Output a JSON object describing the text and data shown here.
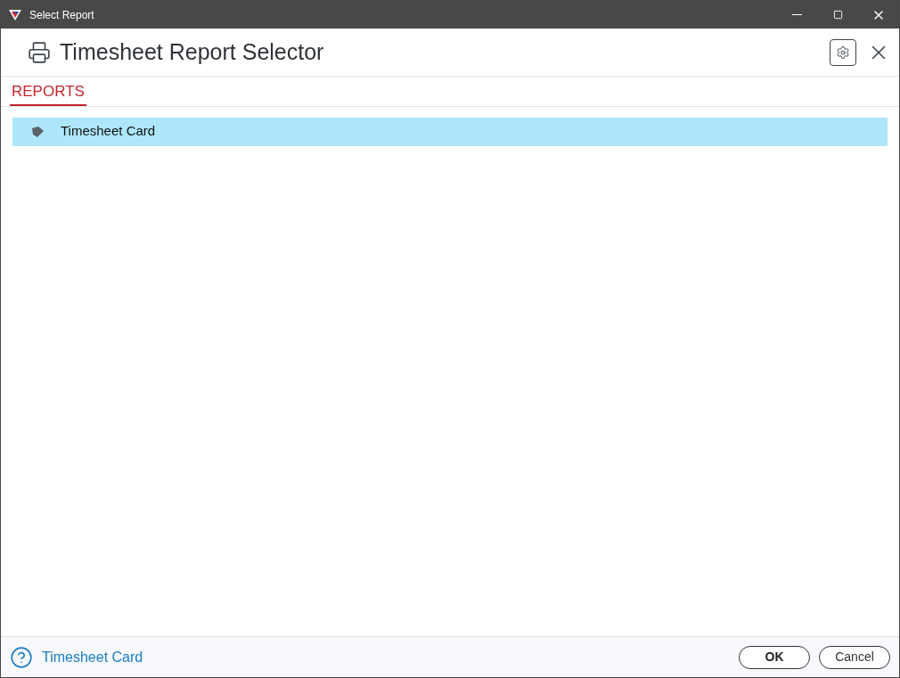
{
  "window": {
    "title": "Select Report"
  },
  "header": {
    "title": "Timesheet Report Selector"
  },
  "tabs": [
    {
      "label": "REPORTS",
      "selected": true
    }
  ],
  "reports": [
    {
      "label": "Timesheet Card",
      "selected": true
    }
  ],
  "footer": {
    "help_link": "Timesheet Card",
    "buttons": [
      {
        "label": "OK",
        "kind": "primary"
      },
      {
        "label": "Cancel",
        "kind": "secondary"
      }
    ]
  }
}
